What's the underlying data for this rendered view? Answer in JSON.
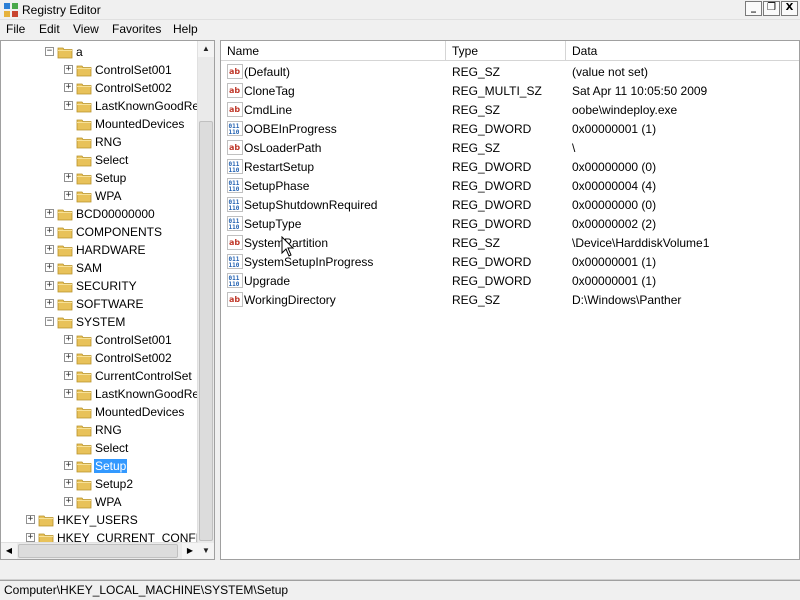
{
  "window": {
    "title": "Registry Editor",
    "minimize_glyph": "_",
    "restore_glyph": "❐",
    "close_glyph": "X"
  },
  "menu": [
    "File",
    "Edit",
    "View",
    "Favorites",
    "Help"
  ],
  "tree": {
    "rows": [
      {
        "label": "a",
        "expanded": true
      },
      {
        "label": "ControlSet001"
      },
      {
        "label": "ControlSet002"
      },
      {
        "label": "LastKnownGoodRe"
      },
      {
        "label": "MountedDevices"
      },
      {
        "label": "RNG"
      },
      {
        "label": "Select"
      },
      {
        "label": "Setup"
      },
      {
        "label": "WPA"
      },
      {
        "label": "BCD00000000"
      },
      {
        "label": "COMPONENTS"
      },
      {
        "label": "HARDWARE"
      },
      {
        "label": "SAM"
      },
      {
        "label": "SECURITY"
      },
      {
        "label": "SOFTWARE"
      },
      {
        "label": "SYSTEM",
        "expanded": true
      },
      {
        "label": "ControlSet001"
      },
      {
        "label": "ControlSet002"
      },
      {
        "label": "CurrentControlSet"
      },
      {
        "label": "LastKnownGoodRe"
      },
      {
        "label": "MountedDevices"
      },
      {
        "label": "RNG"
      },
      {
        "label": "Select"
      },
      {
        "label": "Setup",
        "selected": true
      },
      {
        "label": "Setup2"
      },
      {
        "label": "WPA"
      },
      {
        "label": "HKEY_USERS"
      },
      {
        "label": "HKEY_CURRENT_CONFIG"
      }
    ]
  },
  "list": {
    "columns": [
      "Name",
      "Type",
      "Data"
    ],
    "values": [
      {
        "name": "(Default)",
        "type": "REG_SZ",
        "data": "(value not set)",
        "icon": "string-value-icon"
      },
      {
        "name": "CloneTag",
        "type": "REG_MULTI_SZ",
        "data": "Sat Apr 11 10:05:50 2009",
        "icon": "string-value-icon"
      },
      {
        "name": "CmdLine",
        "type": "REG_SZ",
        "data": "oobe\\windeploy.exe",
        "icon": "string-value-icon"
      },
      {
        "name": "OOBEInProgress",
        "type": "REG_DWORD",
        "data": "0x00000001 (1)",
        "icon": "binary-value-icon"
      },
      {
        "name": "OsLoaderPath",
        "type": "REG_SZ",
        "data": "\\",
        "icon": "string-value-icon"
      },
      {
        "name": "RestartSetup",
        "type": "REG_DWORD",
        "data": "0x00000000 (0)",
        "icon": "binary-value-icon"
      },
      {
        "name": "SetupPhase",
        "type": "REG_DWORD",
        "data": "0x00000004 (4)",
        "icon": "binary-value-icon"
      },
      {
        "name": "SetupShutdownRequired",
        "type": "REG_DWORD",
        "data": "0x00000000 (0)",
        "icon": "binary-value-icon"
      },
      {
        "name": "SetupType",
        "type": "REG_DWORD",
        "data": "0x00000002 (2)",
        "icon": "binary-value-icon"
      },
      {
        "name": "SystemPartition",
        "type": "REG_SZ",
        "data": "\\Device\\HarddiskVolume1",
        "icon": "string-value-icon"
      },
      {
        "name": "SystemSetupInProgress",
        "type": "REG_DWORD",
        "data": "0x00000001 (1)",
        "icon": "binary-value-icon"
      },
      {
        "name": "Upgrade",
        "type": "REG_DWORD",
        "data": "0x00000001 (1)",
        "icon": "binary-value-icon"
      },
      {
        "name": "WorkingDirectory",
        "type": "REG_SZ",
        "data": "D:\\Windows\\Panther",
        "icon": "string-value-icon"
      }
    ]
  },
  "status": {
    "path": "Computer\\HKEY_LOCAL_MACHINE\\SYSTEM\\Setup"
  },
  "colors": {
    "selection": "#3399ff",
    "folder": "#e8c25a"
  }
}
